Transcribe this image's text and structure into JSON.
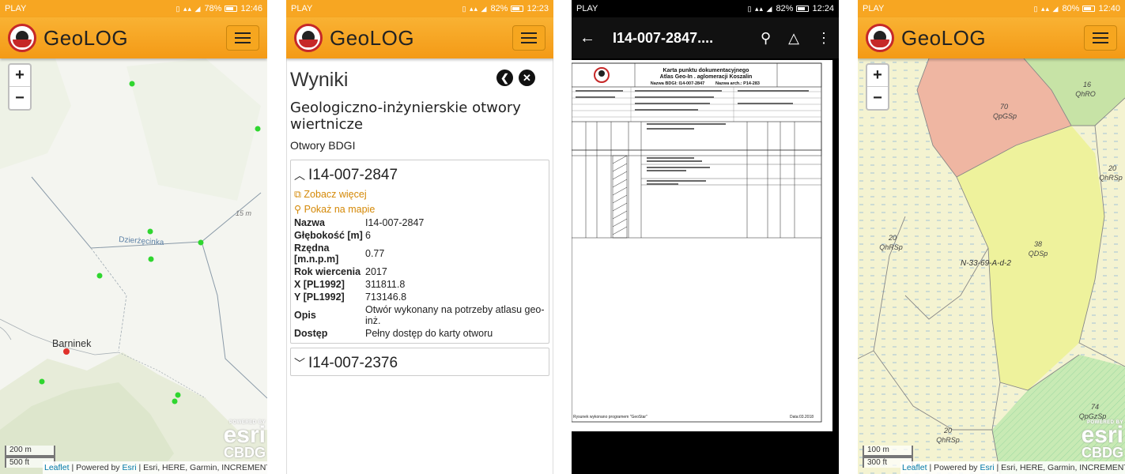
{
  "screens": {
    "map1": {
      "status": {
        "carrier": "PLAY",
        "battery": "78%",
        "time": "12:46"
      },
      "app_title": "GeoLOG",
      "places": {
        "dzierzecinka": "Dzierżęcinka",
        "barninek": "Barninek",
        "elevation": "15 m"
      },
      "scale": {
        "metric": "200 m",
        "imperial": "500 ft"
      }
    },
    "results": {
      "status": {
        "carrier": "PLAY",
        "battery": "82%",
        "time": "12:23"
      },
      "app_title": "GeoLOG",
      "heading": "Wyniki",
      "category": "Geologiczno-inżynierskie otwory wiertnicze",
      "subcategory": "Otwory BDGI",
      "expanded": {
        "title": "I14-007-2847",
        "see_more": "Zobacz więcej",
        "show_on_map": "Pokaż na mapie",
        "rows": [
          {
            "k": "Nazwa",
            "v": "I14-007-2847"
          },
          {
            "k": "Głębokość [m]",
            "v": "6"
          },
          {
            "k": "Rzędna [m.n.p.m]",
            "v": "0.77"
          },
          {
            "k": "Rok wiercenia",
            "v": "2017"
          },
          {
            "k": "X [PL1992]",
            "v": "311811.8"
          },
          {
            "k": "Y [PL1992]",
            "v": "713146.8"
          },
          {
            "k": "Opis",
            "v": "Otwór wykonany na potrzeby atlasu geo-inż."
          },
          {
            "k": "Dostęp",
            "v": "Pełny dostęp do karty otworu"
          }
        ]
      },
      "collapsed": {
        "title": "I14-007-2376"
      }
    },
    "pdf": {
      "status": {
        "carrier": "PLAY",
        "battery": "82%",
        "time": "12:24"
      },
      "title": "I14-007-2847....",
      "doc": {
        "title1": "Karta punktu dokumentacyjnego",
        "title2": "Atlas Geo-In . aglomeracji Koszalin",
        "name": "Nazwa BDGI: I14-007-2847",
        "arch": "Nazwa arch.: P14-283",
        "footer_left": "Rysunek wykonano programem \"GeoStar\"",
        "footer_right": "Data:03.2018"
      }
    },
    "map2": {
      "status": {
        "carrier": "PLAY",
        "battery": "80%",
        "time": "12:40"
      },
      "app_title": "GeoLOG",
      "labels": [
        {
          "n": "70",
          "c": "QpGSp"
        },
        {
          "n": "16",
          "c": "QhRO"
        },
        {
          "n": "20",
          "c": "QhRSp"
        },
        {
          "n": "38",
          "c": "QDSp"
        },
        {
          "n": "20",
          "c": "QhRSp"
        },
        {
          "n": "74",
          "c": "QpGzSp"
        },
        {
          "n": "20",
          "c": "QhRSp"
        }
      ],
      "sheet": "N-33-69-A-d-2",
      "scale": {
        "metric": "100 m",
        "imperial": "300 ft"
      }
    }
  },
  "attribution": {
    "leaflet": "Leaflet",
    "powered": " | Powered by ",
    "esri": "Esri",
    "rest": " | Esri, HERE, Garmin, INCREMENT ..."
  },
  "esri_logo": {
    "powered": "POWERED BY",
    "esri": "esri",
    "cbdg": "CBDG"
  }
}
